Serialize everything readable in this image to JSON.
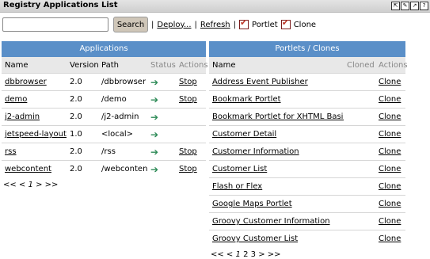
{
  "window": {
    "title": "Registry Applications List",
    "buttons": [
      "⇱",
      "✎",
      "↗",
      "?"
    ]
  },
  "toolbar": {
    "search_placeholder": "",
    "search_value": "",
    "search_button": "Search",
    "sep": "|",
    "deploy": "Deploy...",
    "refresh": "Refresh",
    "portlet_label": "Portlet",
    "clone_label": "Clone"
  },
  "apps": {
    "header": "Applications",
    "columns": [
      "Name",
      "Version",
      "Path",
      "Status",
      "Actions"
    ],
    "rows": [
      {
        "name": "dbbrowser",
        "version": "2.0",
        "path": "/dbbrowser",
        "status": "➔",
        "action": "Stop"
      },
      {
        "name": "demo",
        "version": "2.0",
        "path": "/demo",
        "status": "➔",
        "action": "Stop"
      },
      {
        "name": "j2-admin",
        "version": "2.0",
        "path": "/j2-admin",
        "status": "➔",
        "action": ""
      },
      {
        "name": "jetspeed-layouts",
        "version": "1.0",
        "path": "<local>",
        "status": "➔",
        "action": ""
      },
      {
        "name": "rss",
        "version": "2.0",
        "path": "/rss",
        "status": "➔",
        "action": "Stop"
      },
      {
        "name": "webcontent",
        "version": "2.0",
        "path": "/webcontent",
        "status": "➔",
        "action": "Stop"
      }
    ],
    "pager": {
      "prev": "<< <",
      "current": "1",
      "next": "> >>"
    }
  },
  "portlets": {
    "header": "Portlets / Clones",
    "columns": [
      "Name",
      "Cloned",
      "Actions"
    ],
    "rows": [
      {
        "name": "Address Event Publisher",
        "action": "Clone"
      },
      {
        "name": "Bookmark Portlet",
        "action": "Clone"
      },
      {
        "name": "Bookmark Portlet for XHTML Basic",
        "action": "Clone"
      },
      {
        "name": "Customer Detail",
        "action": "Clone"
      },
      {
        "name": "Customer Information",
        "action": "Clone"
      },
      {
        "name": "Customer List",
        "action": "Clone"
      },
      {
        "name": "Flash or Flex",
        "action": "Clone"
      },
      {
        "name": "Google Maps Portlet",
        "action": "Clone"
      },
      {
        "name": "Groovy Customer Information",
        "action": "Clone"
      },
      {
        "name": "Groovy Customer List",
        "action": "Clone"
      }
    ],
    "pager": {
      "prev": "<< <",
      "pages": [
        "1",
        "2",
        "3"
      ],
      "next": "> >>"
    }
  }
}
